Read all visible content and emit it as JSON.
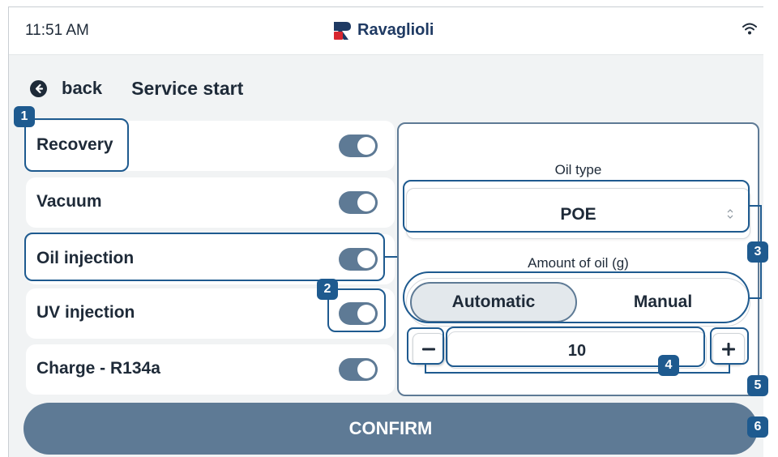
{
  "status_bar": {
    "time": "11:51 AM",
    "brand": "Ravaglioli"
  },
  "header": {
    "back_label": "back",
    "title": "Service start"
  },
  "steps": [
    {
      "label": "Recovery",
      "enabled": true
    },
    {
      "label": "Vacuum",
      "enabled": true
    },
    {
      "label": "Oil injection",
      "enabled": true
    },
    {
      "label": "UV injection",
      "enabled": true
    },
    {
      "label": "Charge - R134a",
      "enabled": true
    }
  ],
  "oil_settings": {
    "oil_type_label": "Oil type",
    "oil_type_value": "POE",
    "amount_label": "Amount of oil (g)",
    "modes": [
      "Automatic",
      "Manual"
    ],
    "selected_mode": "Automatic",
    "amount_value": "10"
  },
  "confirm_label": "CONFIRM",
  "callouts": [
    "1",
    "2",
    "3",
    "4",
    "5",
    "6"
  ],
  "colors": {
    "accent": "#5e7a95",
    "callout": "#1e5a8f",
    "brand": "#1f3a63",
    "logo_red": "#d8262f"
  }
}
